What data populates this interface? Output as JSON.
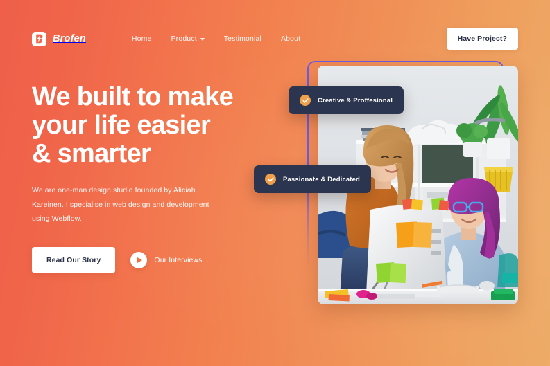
{
  "brand": {
    "name": "Brofen",
    "logo_icon": "lightning-bolt-badge-icon",
    "logo_bg": "#FFFFFF"
  },
  "nav": {
    "items": [
      {
        "label": "Home",
        "has_dropdown": false
      },
      {
        "label": "Product",
        "has_dropdown": true
      },
      {
        "label": "Testimonial",
        "has_dropdown": false
      },
      {
        "label": "About",
        "has_dropdown": false
      }
    ],
    "cta_label": "Have Project?"
  },
  "hero": {
    "headline_lines": [
      "We built to make",
      "your life easier",
      "& smarter"
    ],
    "paragraph": "We are one-man design studio founded by Aliciah Kareinen. I specialise in web design and development using Webflow.",
    "primary_button": "Read Our Story",
    "video_link": {
      "label": "Our Interviews",
      "icon": "play-icon"
    }
  },
  "showcase": {
    "frame_color": "#6C5CE0",
    "photo_alt": "Two women collaborating at an office desk with a monitor covered in sticky notes",
    "badges": [
      {
        "label": "Creative & Proffesional",
        "icon": "check-circle-icon"
      },
      {
        "label": "Passionate & Dedicated",
        "icon": "check-circle-icon"
      }
    ]
  },
  "theme": {
    "gradient_start": "#EF5F4A",
    "gradient_end": "#EDAB67",
    "badge_bg": "#2C3550",
    "accent_orange": "#EFA049",
    "text_dark": "#2B3247"
  }
}
